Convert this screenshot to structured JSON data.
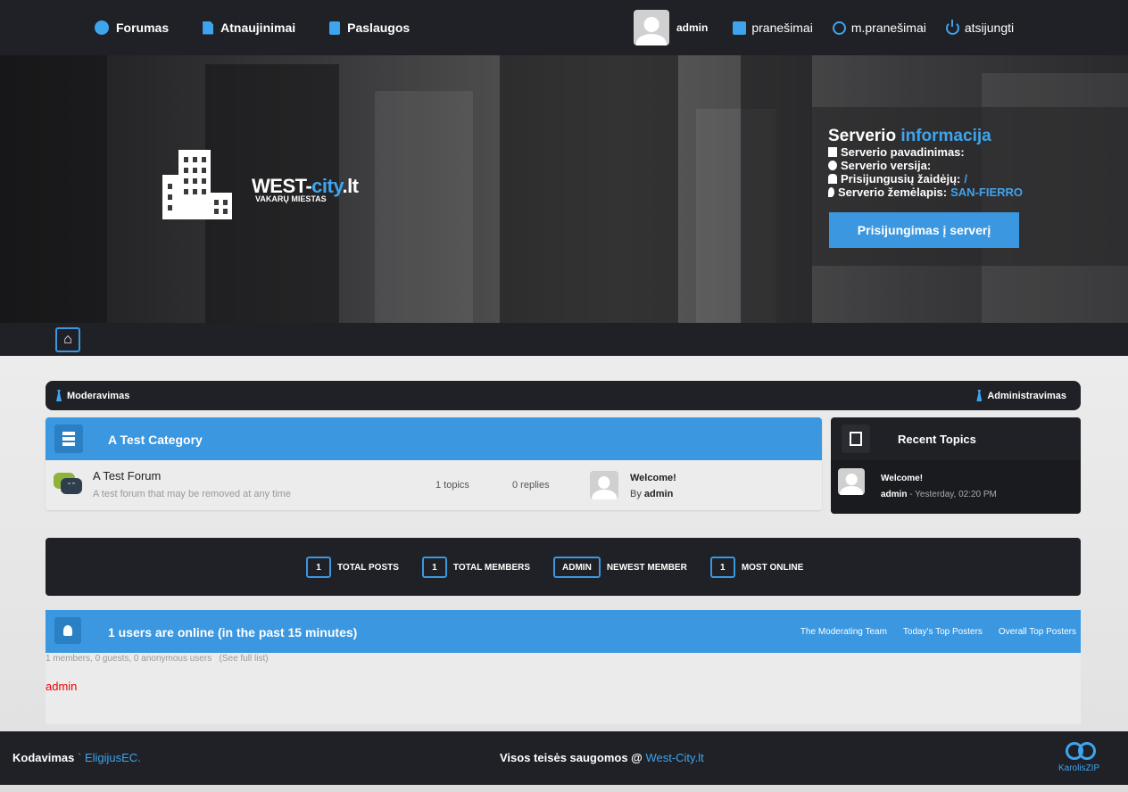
{
  "nav": {
    "items": [
      {
        "label": "Forumas",
        "icon": "chat-bubble-icon"
      },
      {
        "label": "Atnaujinimai",
        "icon": "document-icon"
      },
      {
        "label": "Paslaugos",
        "icon": "bag-icon"
      }
    ],
    "user": "admin",
    "links": [
      {
        "label": "pranešimai",
        "icon": "message-icon"
      },
      {
        "label": "m.pranešimai",
        "icon": "globe-icon"
      },
      {
        "label": "atsijungti",
        "icon": "power-icon"
      }
    ]
  },
  "brand": {
    "name_prefix": "WEST-",
    "name_highlight": "city",
    "name_suffix": ".lt",
    "subtitle": "VAKARŲ MIESTAS"
  },
  "server": {
    "title_plain": "Serverio",
    "title_highlight": "informacija",
    "rows": [
      {
        "label": "Serverio pavadinimas:",
        "value": ""
      },
      {
        "label": "Serverio versija:",
        "value": ""
      },
      {
        "label": "Prisijungusių žaidėjų:",
        "value": "/"
      },
      {
        "label": "Serverio žemėlapis:",
        "value": "SAN-FIERRO"
      }
    ],
    "connect_label": "Prisijungimas į serverį"
  },
  "modbar": {
    "left": "Moderavimas",
    "right": "Administravimas"
  },
  "category": {
    "title": "A Test Category",
    "forum": {
      "name": "A Test Forum",
      "description": "A test forum that may be removed at any time",
      "topics": "1 topics",
      "replies": "0 replies",
      "last_title": "Welcome!",
      "last_by_prefix": "By",
      "last_by_user": "admin"
    }
  },
  "recent": {
    "title": "Recent Topics",
    "item_title": "Welcome!",
    "item_user": "admin",
    "item_time": " - Yesterday, 02:20 PM"
  },
  "stats": [
    {
      "value": "1",
      "label": "TOTAL POSTS"
    },
    {
      "value": "1",
      "label": "TOTAL MEMBERS"
    },
    {
      "value": "ADMIN",
      "label": "NEWEST MEMBER"
    },
    {
      "value": "1",
      "label": "MOST ONLINE"
    }
  ],
  "online": {
    "title": "1 users are online (in the past 15 minutes)",
    "links": [
      "The Moderating Team",
      "Today's Top Posters",
      "Overall Top Posters"
    ],
    "sub": "1 members, 0 guests, 0 anonymous users",
    "full_list": "(See full list)",
    "user": "admin"
  },
  "footer": {
    "left_label": "Kodavimas",
    "left_sep": " ` ",
    "left_link": "EligijusEC.",
    "center_label": "Visos teisės saugomos @ ",
    "center_link": "West-City.lt",
    "logo_text": "KarolisZIP"
  },
  "colors": {
    "accent": "#3a97e0",
    "dark": "#1f2126",
    "online_user": "#e00000"
  }
}
